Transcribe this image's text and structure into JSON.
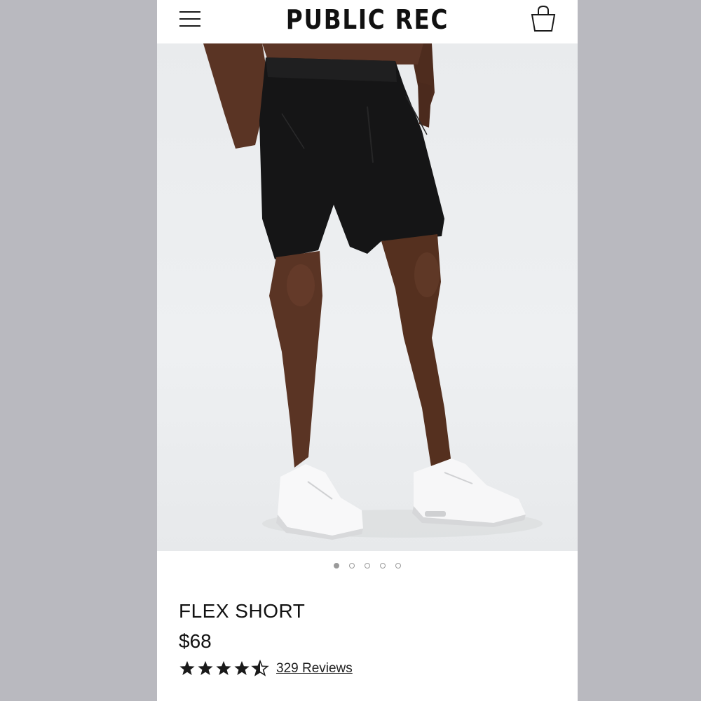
{
  "header": {
    "brand": "PUBLIC REC",
    "menu_icon": "hamburger-menu-icon",
    "bag_icon": "shopping-bag-icon"
  },
  "gallery": {
    "image_count": 5,
    "active_index": 0,
    "image_alt": "Model wearing black shorts and white sneakers"
  },
  "product": {
    "name": "FLEX SHORT",
    "price": "$68",
    "rating": 4.5,
    "rating_max": 5,
    "reviews_label": "329 Reviews"
  },
  "colors": {
    "background": "#b9b9bf",
    "text": "#111111",
    "star": "#1a1a1a"
  }
}
